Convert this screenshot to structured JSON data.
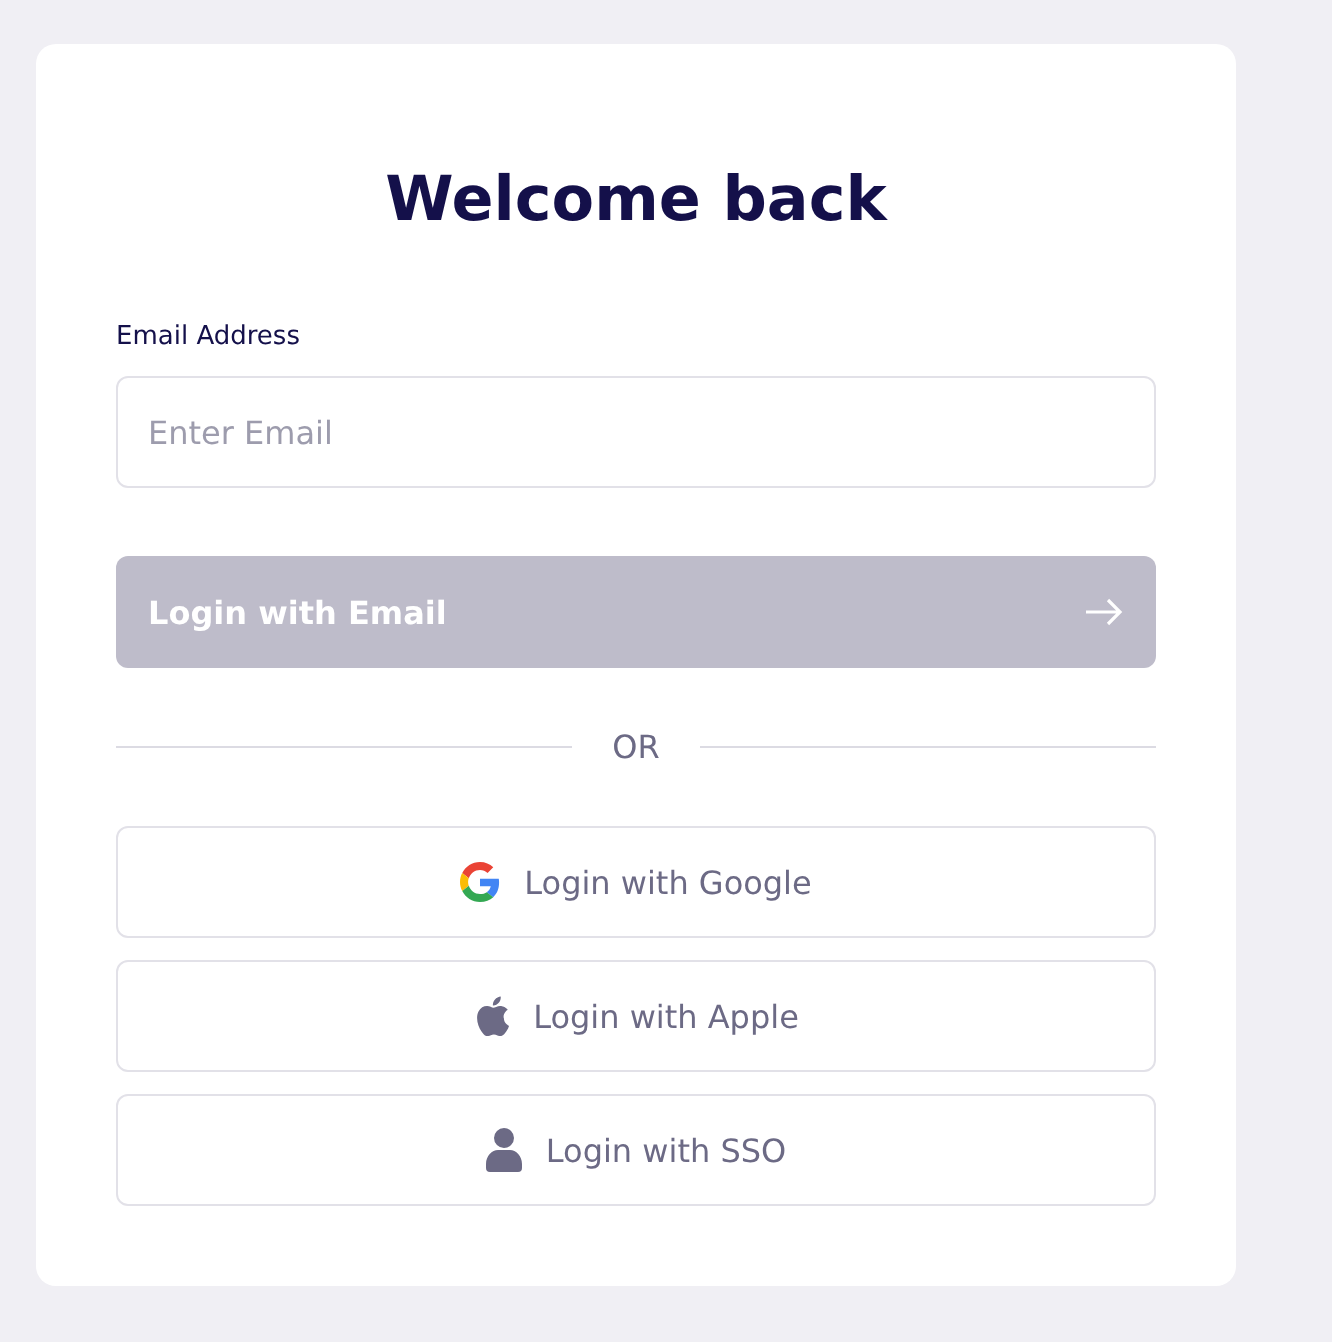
{
  "title": "Welcome back",
  "email": {
    "label": "Email Address",
    "placeholder": "Enter Email"
  },
  "email_button": {
    "label": "Login with Email",
    "disabled": true
  },
  "divider": "OR",
  "providers": [
    {
      "kind": "google",
      "label": "Login with Google"
    },
    {
      "kind": "apple",
      "label": "Login with Apple"
    },
    {
      "kind": "sso",
      "label": "Login with SSO"
    }
  ]
}
